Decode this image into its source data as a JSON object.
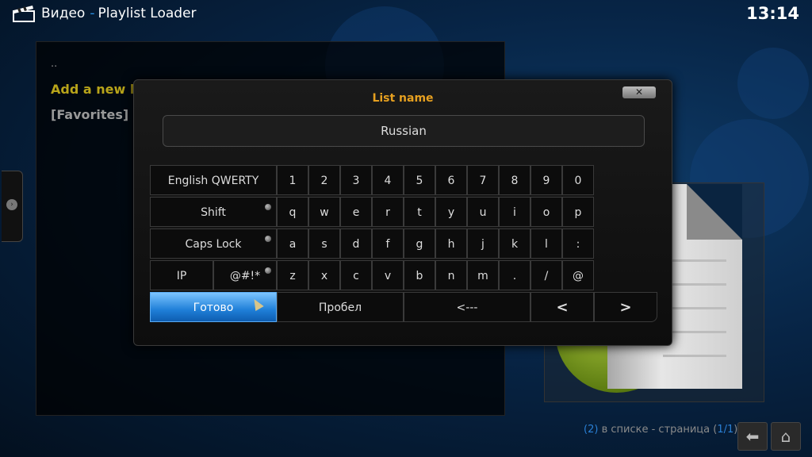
{
  "header": {
    "app_icon": "clapperboard-icon",
    "section": "Видео",
    "separator": "-",
    "plugin": "Playlist Loader",
    "clock": "13:14"
  },
  "list": {
    "items": [
      "..",
      "Add a new list",
      "[Favorites]"
    ]
  },
  "side_tab": {
    "icon": "chevron-right-icon",
    "glyph": "›"
  },
  "status": {
    "count": "2",
    "text_in_list": "в списке - страница",
    "page_open": "(",
    "page": "1/1",
    "page_close": ")"
  },
  "nav": {
    "back_icon": "back-arrow-icon",
    "back_glyph": "⬅",
    "home_icon": "home-icon",
    "home_glyph": "⌂"
  },
  "dialog": {
    "heading": "List name",
    "close_label": "✕",
    "input_value": "Russian"
  },
  "keyboard": {
    "layout_label": "English QWERTY",
    "shift_label": "Shift",
    "caps_label": "Caps Lock",
    "ip_label": "IP",
    "symbols_label": "@#!*",
    "done_label": "Готово",
    "space_label": "Пробел",
    "backspace_label": "<---",
    "left_label": "<",
    "right_label": ">",
    "row1": [
      "1",
      "2",
      "3",
      "4",
      "5",
      "6",
      "7",
      "8",
      "9",
      "0"
    ],
    "row2": [
      "q",
      "w",
      "e",
      "r",
      "t",
      "y",
      "u",
      "i",
      "o",
      "p"
    ],
    "row3": [
      "a",
      "s",
      "d",
      "f",
      "g",
      "h",
      "j",
      "k",
      "l",
      ":"
    ],
    "row4": [
      "z",
      "x",
      "c",
      "v",
      "b",
      "n",
      "m",
      ".",
      "/",
      "@"
    ]
  },
  "colors": {
    "accent_blue": "#2a8fe0",
    "heading_orange": "#e6a020",
    "highlight_yellow": "#b8a41a"
  }
}
